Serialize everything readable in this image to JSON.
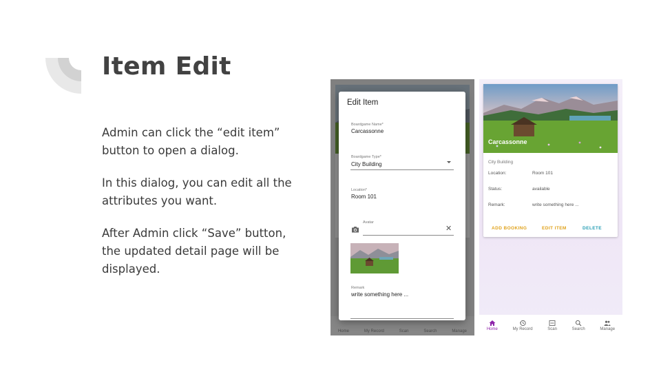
{
  "slide": {
    "title": "Item Edit",
    "paragraphs": [
      "Admin can click the “edit item” button to open a dialog.",
      "In this dialog, you can edit all the attributes you want.",
      "After Admin click “Save” button, the updated detail page will be displayed."
    ]
  },
  "edit_dialog": {
    "title": "Edit Item",
    "fields": {
      "name": {
        "label": "Boardgame Name*",
        "value": "Carcassonne"
      },
      "type": {
        "label": "Boardgame Type*",
        "value": "City Building"
      },
      "location": {
        "label": "Location*",
        "value": "Room 101"
      },
      "avatar": {
        "label": "Avatar",
        "value": ""
      },
      "remark": {
        "label": "Remark",
        "value": "write something here ..."
      }
    },
    "icons": [
      "camera-icon",
      "clear-icon",
      "dropdown-caret-icon"
    ],
    "background_nav": [
      "Home",
      "My Record",
      "Scan",
      "Search",
      "Manage"
    ]
  },
  "detail_page": {
    "name": "Carcassonne",
    "type": "City Building",
    "attributes": [
      {
        "label": "Location:",
        "value": "Room 101"
      },
      {
        "label": "Status:",
        "value": "available"
      },
      {
        "label": "Remark:",
        "value": "write something here ..."
      }
    ],
    "actions": [
      {
        "label": "ADD BOOKING",
        "color": "#e0a21b"
      },
      {
        "label": "EDIT ITEM",
        "color": "#e0a21b"
      },
      {
        "label": "DELETE",
        "color": "#2a9fb5"
      }
    ],
    "nav": [
      {
        "label": "Home",
        "icon": "home-icon",
        "active": true
      },
      {
        "label": "My Record",
        "icon": "history-icon",
        "active": false
      },
      {
        "label": "Scan",
        "icon": "scan-icon",
        "active": false
      },
      {
        "label": "Search",
        "icon": "search-icon",
        "active": false
      },
      {
        "label": "Manage",
        "icon": "manage-icon",
        "active": false
      }
    ],
    "accent_color": "#8e24aa"
  }
}
